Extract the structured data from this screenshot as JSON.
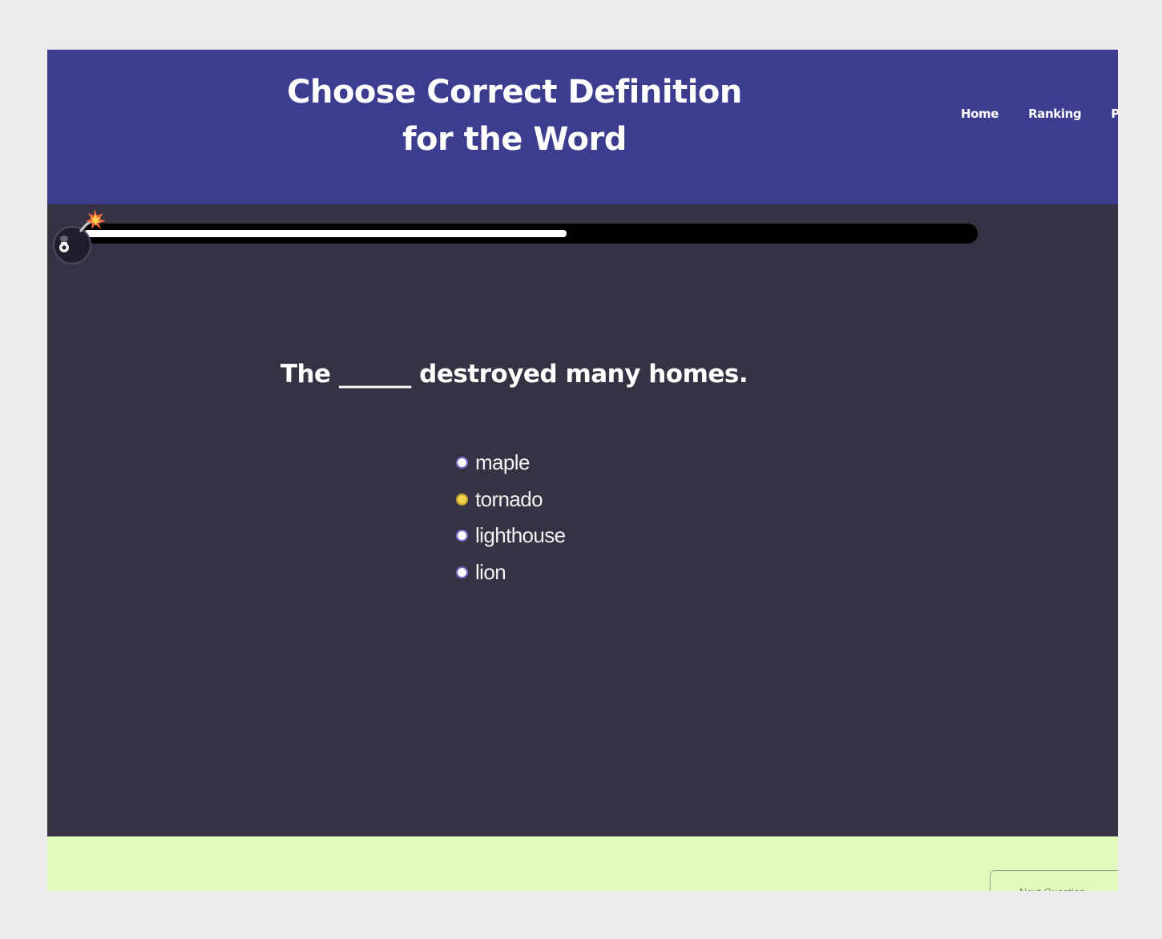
{
  "header": {
    "title": "Choose Correct Definition for the Word",
    "nav": [
      "Home",
      "Ranking",
      "Prof"
    ]
  },
  "timer": {
    "remaining_fraction": 0.54
  },
  "quiz": {
    "question": "The ______ destroyed many homes.",
    "options": [
      {
        "label": "maple",
        "selected": false
      },
      {
        "label": "tornado",
        "selected": true
      },
      {
        "label": "lighthouse",
        "selected": false
      },
      {
        "label": "lion",
        "selected": false
      }
    ]
  },
  "footer": {
    "next_label": "Next Question"
  },
  "colors": {
    "header_bg": "#3c3d8f",
    "main_bg": "#363244",
    "footer_bg": "#e2fbbd",
    "selected_radio": "#f4d24a"
  }
}
